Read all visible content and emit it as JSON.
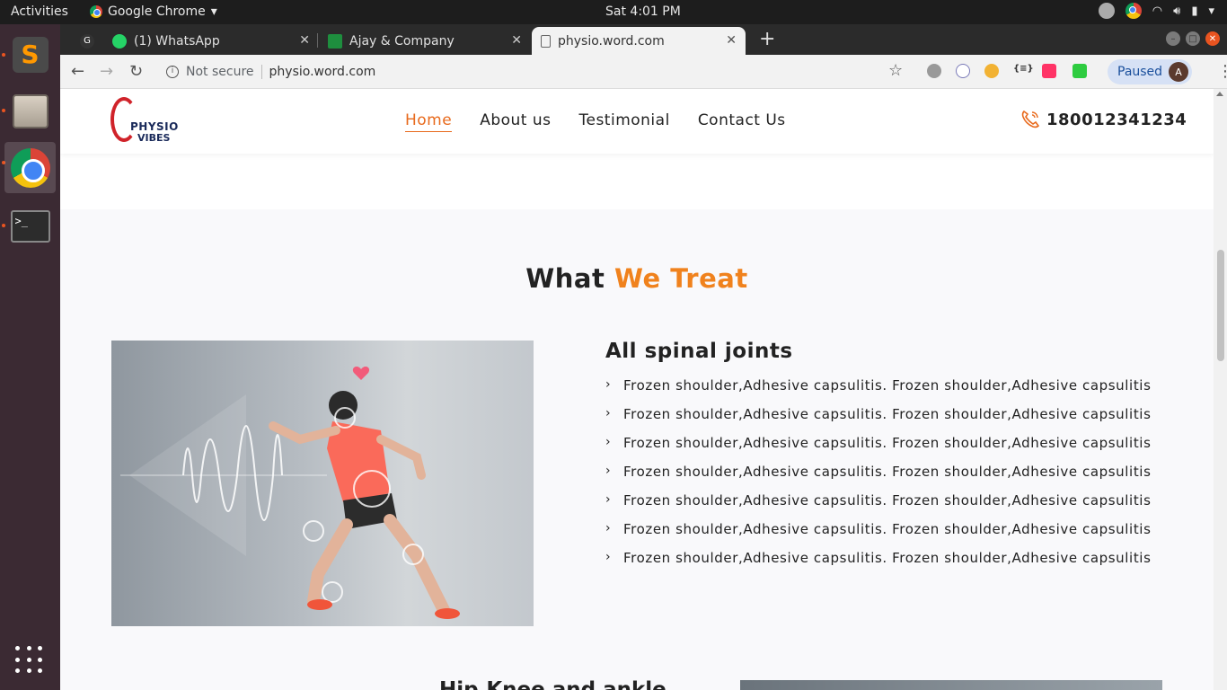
{
  "system": {
    "activities": "Activities",
    "app_menu": "Google Chrome",
    "clock": "Sat  4:01 PM"
  },
  "tabs": [
    {
      "label": "(1) WhatsApp"
    },
    {
      "label": "Ajay & Company"
    },
    {
      "label": "physio.word.com"
    }
  ],
  "address": {
    "security": "Not secure",
    "url": "physio.word.com"
  },
  "profile": {
    "status": "Paused",
    "initial": "A"
  },
  "site": {
    "logo_line1": "PHYSIO",
    "logo_line2": "VIBES",
    "nav": [
      "Home",
      "About us",
      "Testimonial",
      "Contact Us"
    ],
    "phone": "180012341234"
  },
  "section": {
    "title_main": "What",
    "title_accent": "We Treat",
    "card_title": "All spinal joints",
    "items": [
      "Frozen shoulder,Adhesive capsulitis. Frozen shoulder,Adhesive capsulitis",
      "Frozen shoulder,Adhesive capsulitis. Frozen shoulder,Adhesive capsulitis",
      "Frozen shoulder,Adhesive capsulitis. Frozen shoulder,Adhesive capsulitis",
      "Frozen shoulder,Adhesive capsulitis. Frozen shoulder,Adhesive capsulitis",
      "Frozen shoulder,Adhesive capsulitis. Frozen shoulder,Adhesive capsulitis",
      "Frozen shoulder,Adhesive capsulitis. Frozen shoulder,Adhesive capsulitis",
      "Frozen shoulder,Adhesive capsulitis. Frozen shoulder,Adhesive capsulitis"
    ],
    "next_title": "Hip,Knee and ankle"
  },
  "colors": {
    "accent": "#f0821d",
    "nav_active": "#e86a1d",
    "logo_red": "#d0232a"
  }
}
